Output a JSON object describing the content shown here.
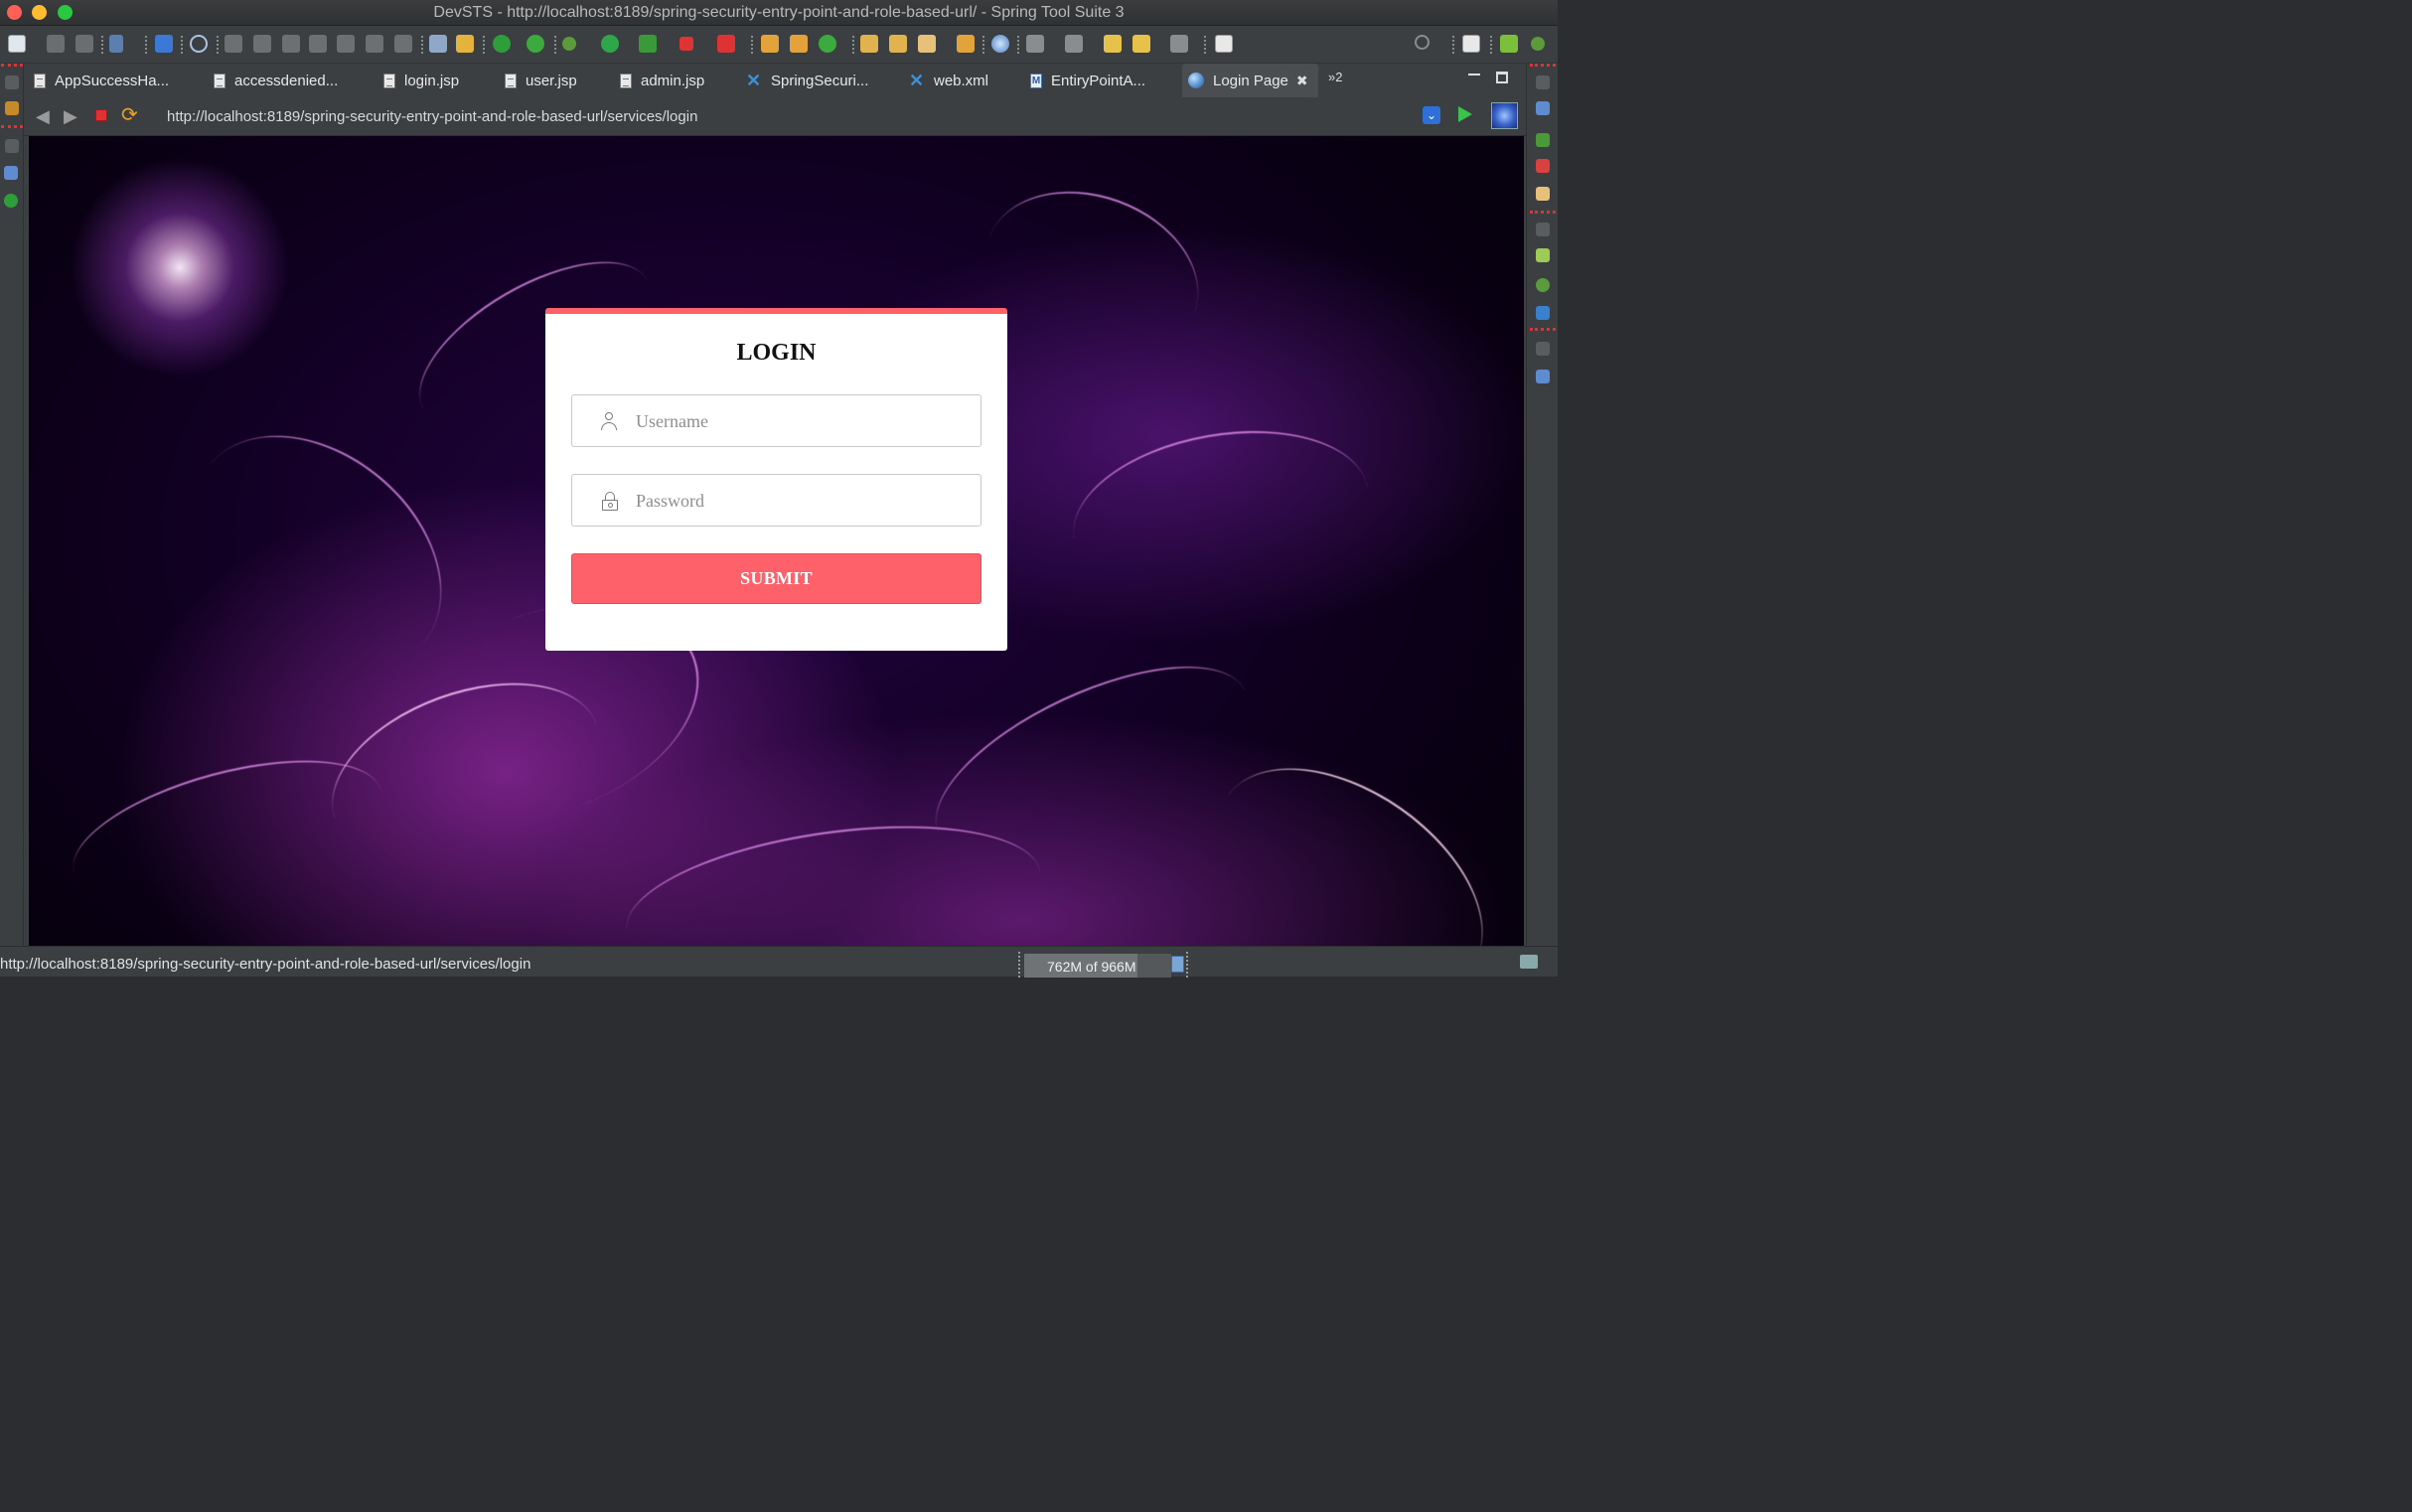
{
  "window": {
    "title": "DevSTS - http://localhost:8189/spring-security-entry-point-and-role-based-url/ - Spring Tool Suite 3"
  },
  "tabs": [
    {
      "label": "AppSuccessHa...",
      "icon": "java-file-icon"
    },
    {
      "label": "accessdenied...",
      "icon": "jsp-file-icon"
    },
    {
      "label": "login.jsp",
      "icon": "jsp-file-icon"
    },
    {
      "label": "user.jsp",
      "icon": "jsp-file-icon"
    },
    {
      "label": "admin.jsp",
      "icon": "jsp-file-icon"
    },
    {
      "label": "SpringSecuri...",
      "icon": "xml-file-icon"
    },
    {
      "label": "web.xml",
      "icon": "xml-file-icon"
    },
    {
      "label": "EntiryPointA...",
      "icon": "maven-file-icon"
    },
    {
      "label": "Login Page",
      "icon": "globe-icon",
      "active": true
    }
  ],
  "tabs_overflow": "»2",
  "browser": {
    "url": "http://localhost:8189/spring-security-entry-point-and-role-based-url/services/login"
  },
  "login": {
    "title": "LOGIN",
    "username_placeholder": "Username",
    "password_placeholder": "Password",
    "submit_label": "SUBMIT",
    "accent_color": "#ff6169"
  },
  "status": {
    "text": "http://localhost:8189/spring-security-entry-point-and-role-based-url/services/login",
    "heap": "762M of 966M",
    "heap_used_fraction": 0.79
  }
}
